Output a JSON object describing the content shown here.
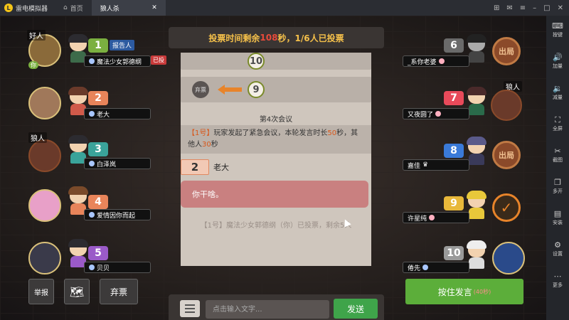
{
  "titlebar": {
    "app_name": "雷电模拟器",
    "logo_glyph": "L",
    "tabs": [
      {
        "label": "首页"
      },
      {
        "label": "狼人杀"
      }
    ]
  },
  "sidebar": {
    "items": [
      {
        "label": "按键",
        "icon": "keyboard-icon"
      },
      {
        "label": "加量",
        "icon": "volume-up-icon"
      },
      {
        "label": "减量",
        "icon": "volume-down-icon"
      },
      {
        "label": "全屏",
        "icon": "fullscreen-icon"
      },
      {
        "label": "截图",
        "icon": "scissors-icon"
      },
      {
        "label": "多开",
        "icon": "multi-window-icon"
      },
      {
        "label": "安装",
        "icon": "install-icon"
      },
      {
        "label": "设置",
        "icon": "gear-icon"
      },
      {
        "label": "更多",
        "icon": "more-icon"
      }
    ]
  },
  "banner": {
    "prefix": "投票时间剩余",
    "seconds": "108",
    "suffix": "秒，1/6人已投票"
  },
  "players_left": [
    {
      "num": "1",
      "name": "魔法少女郭德纲",
      "role": "好人",
      "you": "你",
      "report": "报告人",
      "voted": "已投",
      "num_color": "#7bb040"
    },
    {
      "num": "2",
      "name": "老大",
      "role": "",
      "num_color": "#e8845a"
    },
    {
      "num": "3",
      "name": "白泽岚",
      "role": "狼人",
      "num_color": "#3aa39a"
    },
    {
      "num": "4",
      "name": "爱情因你而起",
      "role": "",
      "num_color": "#e8845a"
    },
    {
      "num": "5",
      "name": "贝贝",
      "role": "",
      "num_color": "#9a5ac8"
    }
  ],
  "players_right": [
    {
      "num": "6",
      "name": "_系你老婆",
      "role": "",
      "stamp": "出局",
      "num_color": "#6a6a6a"
    },
    {
      "num": "7",
      "name": "又夜圆了",
      "role": "狼人",
      "num_color": "#e84a5a"
    },
    {
      "num": "8",
      "name": "嘉佳",
      "role": "",
      "stamp": "出局",
      "num_color": "#3a7ad8"
    },
    {
      "num": "9",
      "name": "许星纯",
      "role": "",
      "stamp": "✓",
      "num_color": "#e8b83a"
    },
    {
      "num": "10",
      "name": "倦先",
      "role": "",
      "num_color": "#9a9a9a"
    }
  ],
  "vote_cards": [
    {
      "target": "10"
    },
    {
      "voter_label": "弃票",
      "target": "9"
    }
  ],
  "meeting_title": "第4次会议",
  "sysmsg": {
    "bracket": "【1号】",
    "text_a": "玩家发起了紧急会议，本轮发言时长",
    "num_a": "50",
    "text_b": "秒，其他人",
    "num_b": "30",
    "text_c": "秒"
  },
  "speaker": {
    "num": "2",
    "name": "老大"
  },
  "speech_bubble": "你干啥。",
  "faded_msg": "【1号】魔法少女郭德纲（你）已投票，剩余5人",
  "input": {
    "placeholder": "点击输入文字...",
    "send_label": "发送"
  },
  "buttons": {
    "report": "举报",
    "abstain": "弃票"
  },
  "talk": {
    "label": "按住发言",
    "time": "(40秒)"
  }
}
